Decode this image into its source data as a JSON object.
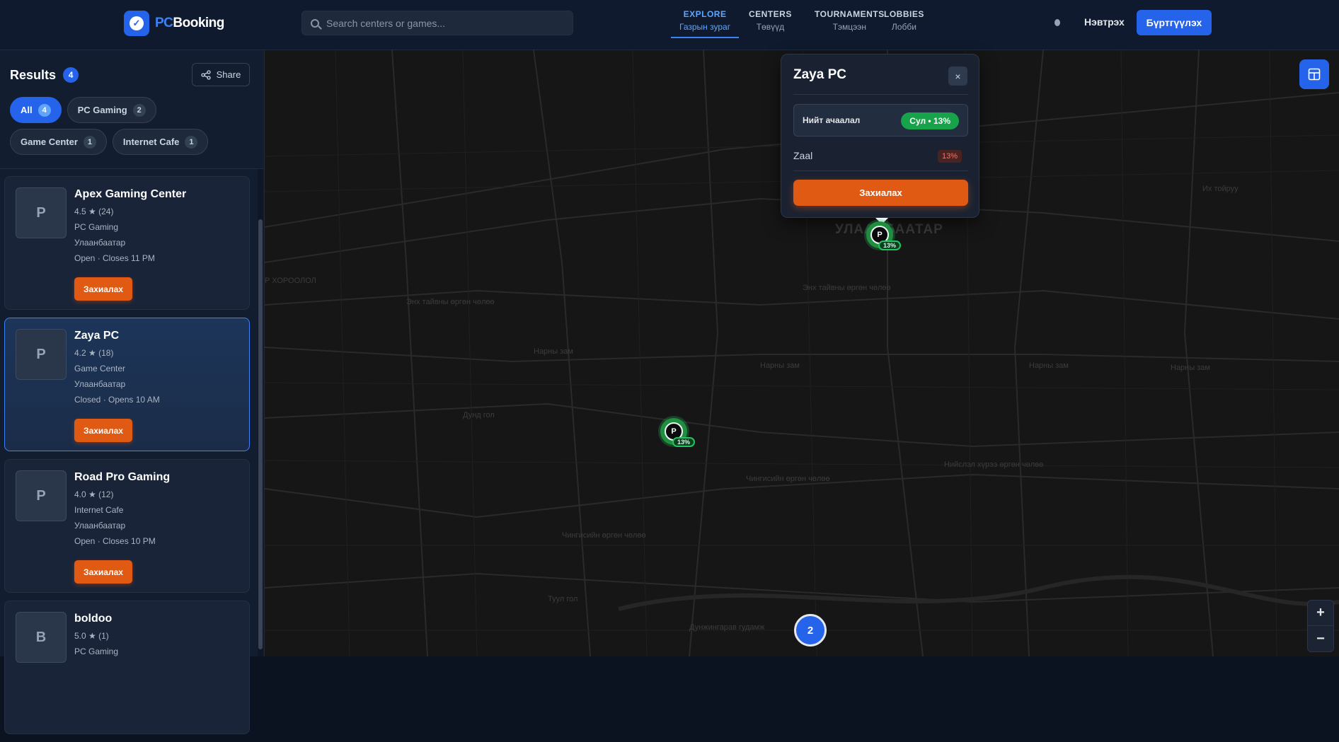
{
  "header": {
    "logo": {
      "part1": "PC",
      "part2": "Booking"
    },
    "search": {
      "placeholder": "Search centers or games..."
    },
    "nav": [
      {
        "title": "EXPLORE",
        "subtitle": "Газрын зураг",
        "active": true
      },
      {
        "title": "CENTERS",
        "subtitle": "Төвүүд",
        "active": false
      },
      {
        "title": "TOURNAMENTS",
        "subtitle": "Тэмцээн",
        "active": false
      },
      {
        "title": "LOBBIES",
        "subtitle": "Лобби",
        "active": false
      }
    ],
    "login_label": "Нэвтрэх",
    "register_label": "Бүртгүүлэх"
  },
  "sidebar": {
    "results_label": "Results",
    "results_count": "4",
    "share_label": "Share",
    "filters": [
      {
        "label": "All",
        "count": "4",
        "active": true
      },
      {
        "label": "PC Gaming",
        "count": "2",
        "active": false
      },
      {
        "label": "Game Center",
        "count": "1",
        "active": false
      },
      {
        "label": "Internet Cafe",
        "count": "1",
        "active": false
      }
    ],
    "centers": [
      {
        "initial": "P",
        "name": "Apex Gaming Center",
        "rating": "4.5 ★ (24)",
        "category": "PC Gaming",
        "city": "Улаанбаатар",
        "hours": "Open · Closes 11 PM",
        "book_label": "Захиалах",
        "selected": false
      },
      {
        "initial": "P",
        "name": "Zaya PC",
        "rating": "4.2 ★ (18)",
        "category": "Game Center",
        "city": "Улаанбаатар",
        "hours": "Closed · Opens 10 AM",
        "book_label": "Захиалах",
        "selected": true
      },
      {
        "initial": "P",
        "name": "Road Pro Gaming",
        "rating": "4.0 ★ (12)",
        "category": "Internet Cafe",
        "city": "Улаанбаатар",
        "hours": "Open · Closes 10 PM",
        "book_label": "Захиалах",
        "selected": false
      },
      {
        "initial": "B",
        "name": "boldoo",
        "rating": "5.0 ★ (1)",
        "category": "PC Gaming",
        "city": "",
        "hours": "",
        "book_label": "",
        "selected": false
      }
    ]
  },
  "map": {
    "popup": {
      "title": "Zaya PC",
      "close_icon": "×",
      "load_label": "Нийт ачаалал",
      "load_badge": "Сул • 13%",
      "room_name": "Zaal",
      "room_pct": "13%",
      "book_label": "Захиалах"
    },
    "pins": [
      {
        "letter": "P",
        "pct": "13%"
      },
      {
        "letter": "P",
        "pct": "13%"
      }
    ],
    "cluster_count": "2",
    "city_label": "УЛААНБААТАР",
    "labels": [
      "Нарны зам",
      "Нарны зам",
      "Нарны зам",
      "Нарны зам",
      "Энх тайвны өргөн чөлөө",
      "Энх тайвны өргөн чөлөө",
      "Чингисийн өргөн чөлөө",
      "Чингисийн өргөн чөлөө",
      "Нийслэл хүрээ өргөн чөлөө",
      "Дунд гол",
      "Туул гол",
      "Дунжингарав гудамж",
      "Р ХОРООЛОЛ",
      "Их тойруу"
    ],
    "zoom_in": "+",
    "zoom_out": "−",
    "colors": {
      "pin_green": "#22c55e",
      "accent_blue": "#2563eb",
      "book_orange": "#e05a14"
    }
  }
}
